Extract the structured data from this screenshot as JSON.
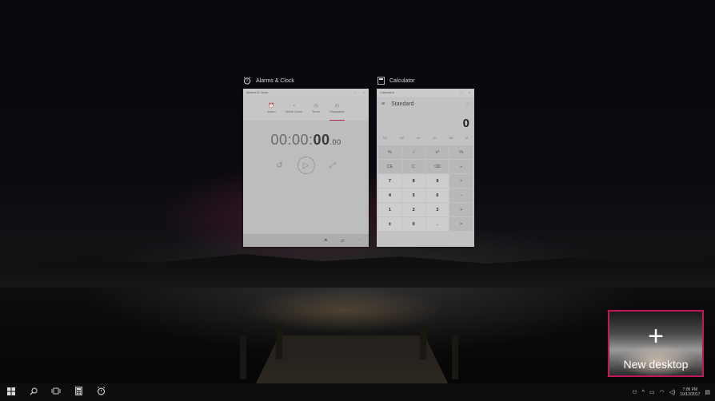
{
  "windows": {
    "alarms": {
      "title": "Alarms & Clock",
      "inner_title": "Alarms & Clock",
      "tabs": [
        {
          "label": "Alarm",
          "icon": "alarm-icon"
        },
        {
          "label": "World Clock",
          "icon": "globe-icon"
        },
        {
          "label": "Timer",
          "icon": "timer-icon"
        },
        {
          "label": "Stopwatch",
          "icon": "stopwatch-icon"
        }
      ],
      "stopwatch_dim": "00:00:",
      "stopwatch_bold": "00",
      "stopwatch_frac": ".00"
    },
    "calculator": {
      "title": "Calculator",
      "inner_title": "Calculator",
      "mode": "Standard",
      "display": "0",
      "memory": [
        "MC",
        "MR",
        "M+",
        "M-",
        "MS",
        "M"
      ],
      "keys": [
        "%",
        "√",
        "x²",
        "¹⁄x",
        "CE",
        "C",
        "⌫",
        "÷",
        "7",
        "8",
        "9",
        "×",
        "4",
        "5",
        "6",
        "−",
        "1",
        "2",
        "3",
        "+",
        "±",
        "0",
        ".",
        "="
      ]
    }
  },
  "new_desktop": {
    "plus": "+",
    "label": "New desktop",
    "highlight_color": "#c2185b"
  },
  "taskbar": {
    "time": "7:06 PM",
    "date": "10/12/2017"
  }
}
